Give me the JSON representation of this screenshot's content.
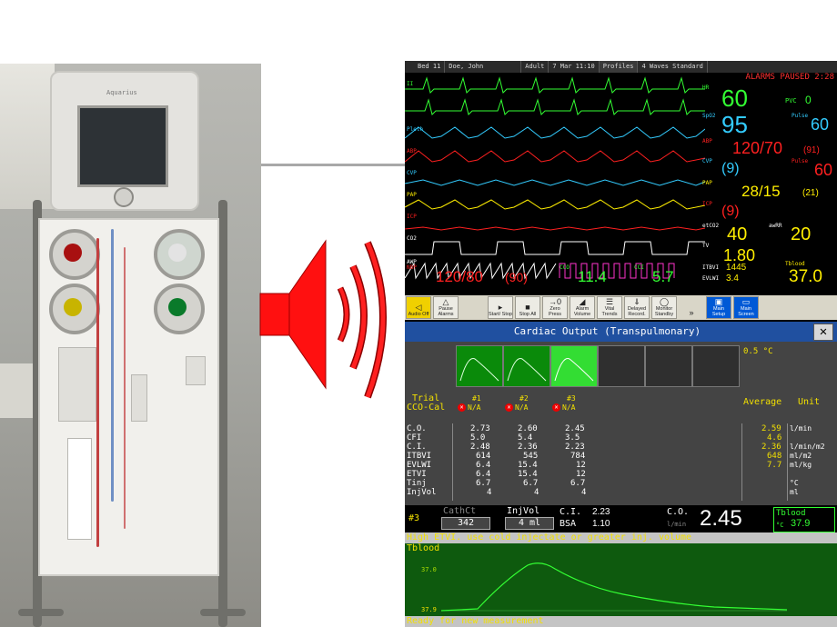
{
  "top_bar": {
    "bed": "Bed 11",
    "patient": "Doe, John",
    "category": "Adult",
    "datetime": "7 Mar 11:10",
    "profiles": "Profiles",
    "waves": "4 Waves Standard"
  },
  "alarm_banner": "ALARMS PAUSED 2:28",
  "waves": [
    {
      "label": "II",
      "color": "#33ff33"
    },
    {
      "label": "",
      "color": "#33ff33"
    },
    {
      "label": "Pleth",
      "color": "#33ccff"
    },
    {
      "label": "ABP",
      "color": "#ff2020"
    },
    {
      "label": "CVP",
      "color": "#33ccff"
    },
    {
      "label": "PAP",
      "color": "#ffee00"
    },
    {
      "label": "ICP",
      "color": "#ff2020"
    },
    {
      "label": "CO2",
      "color": "#ffffff"
    },
    {
      "label": "AWP",
      "color": "#ffffff"
    }
  ],
  "numerics": {
    "hr_label": "HR",
    "hr": "60",
    "pvc_label": "PVC",
    "pvc": "0",
    "spo2_label": "SpO2",
    "spo2": "95",
    "pulse_label": "Pulse",
    "pulse1": "60",
    "abp_label": "ABP",
    "abp": "120/70",
    "abp_mean": "(91)",
    "cvp_label": "CVP",
    "cvp": "(9)",
    "pulse2": "60",
    "pap_label": "PAP",
    "pap": "28/15",
    "pap_mean": "(21)",
    "icp_label": "ICP",
    "icp": "(9)",
    "etco2_label": "etCO2",
    "etco2": "40",
    "awrr_label": "awRR",
    "awrr": "20",
    "tv_label": "TV",
    "tv": "1.80",
    "itbvi_label": "ITBVI",
    "itbvi": "1445",
    "evlwi_label": "EVLWI",
    "evlwi": "3.4",
    "tblood_label": "Tblood",
    "tblood": "37.0",
    "nbp_label": "NBP",
    "nbp": "120/80",
    "nbp_mean": "(90)",
    "cco_label": "CCO",
    "cco": "11.4",
    "cci_label": "CCI",
    "cci": "5.7"
  },
  "toolbar": [
    {
      "label": "Audio Off",
      "icon": "speaker-icon"
    },
    {
      "label": "Pause Alarms",
      "icon": "bell-icon"
    },
    {
      "label": "",
      "icon": ""
    },
    {
      "label": "Start/ Stop",
      "icon": "start-icon"
    },
    {
      "label": "Stop All",
      "icon": "stop-icon"
    },
    {
      "label": "Zero Press",
      "icon": "zero-icon"
    },
    {
      "label": "Alarm Volume",
      "icon": "volume-icon"
    },
    {
      "label": "Vital Trends",
      "icon": "trend-icon"
    },
    {
      "label": "Delayed Record.",
      "icon": "record-icon"
    },
    {
      "label": "Monitor Standby",
      "icon": "standby-icon"
    },
    {
      "label": "",
      "icon": "more-icon"
    },
    {
      "label": "Main Setup",
      "icon": "setup-icon"
    },
    {
      "label": "Main Screen",
      "icon": "screen-icon"
    }
  ],
  "co": {
    "title": "Cardiac Output (Transpulmonary)",
    "temp_delta": "0.5 °C",
    "trial_label": "Trial",
    "cco_cal_label": "CCO-Cal",
    "trials": [
      "#1",
      "#2",
      "#3"
    ],
    "na": "N/A",
    "average_label": "Average",
    "unit_label": "Unit",
    "rows": [
      {
        "name": "C.O.",
        "t1": "2.73",
        "t2": "2.60",
        "t3": "2.45",
        "avg": "2.59",
        "unit": "l/min"
      },
      {
        "name": "CFI",
        "t1": "5.0",
        "t2": "5.4",
        "t3": "3.5",
        "avg": "4.6",
        "unit": ""
      },
      {
        "name": "C.I.",
        "t1": "2.48",
        "t2": "2.36",
        "t3": "2.23",
        "avg": "2.36",
        "unit": "l/min/m2"
      },
      {
        "name": "ITBVI",
        "t1": "614",
        "t2": "545",
        "t3": "784",
        "avg": "648",
        "unit": "ml/m2"
      },
      {
        "name": "EVLWI",
        "t1": "6.4",
        "t2": "15.4",
        "t3": "12",
        "avg": "7.7",
        "unit": "ml/kg"
      },
      {
        "name": "ETVI",
        "t1": "6.4",
        "t2": "15.4",
        "t3": "12",
        "avg": "",
        "unit": ""
      },
      {
        "name": "Tinj",
        "t1": "6.7",
        "t2": "6.7",
        "t3": "6.7",
        "avg": "",
        "unit": "°C"
      },
      {
        "name": "InjVol",
        "t1": "4",
        "t2": "4",
        "t3": "4",
        "avg": "",
        "unit": "ml"
      }
    ],
    "summary": {
      "trial_no": "#3",
      "catheter_label": "CathCt",
      "catheter_value": "342",
      "injvol_label": "InjVol",
      "injvol_value": "4 ml",
      "ci_label": "C.I.",
      "ci_value": "2.23",
      "bsa_label": "BSA",
      "bsa_value": "1.10",
      "co_label": "C.O.",
      "co_unit": "l/min",
      "co_value": "2.45",
      "tblood_label": "Tblood",
      "tblood_unit": "°C",
      "tblood_value": "37.9"
    },
    "message": "High ETVI. use cold injectate or greater inj. volume",
    "plot_label": "Tblood",
    "plot_ytick_top": "37.0",
    "plot_ytick_bottom": "37.9",
    "status": "Ready for new measurement"
  },
  "colors": {
    "ecg": "#33ff33",
    "spo2": "#33ccff",
    "abp": "#ff2020",
    "pap": "#ffee00",
    "titlebar": "#2050a0",
    "message": "#f2e000"
  }
}
